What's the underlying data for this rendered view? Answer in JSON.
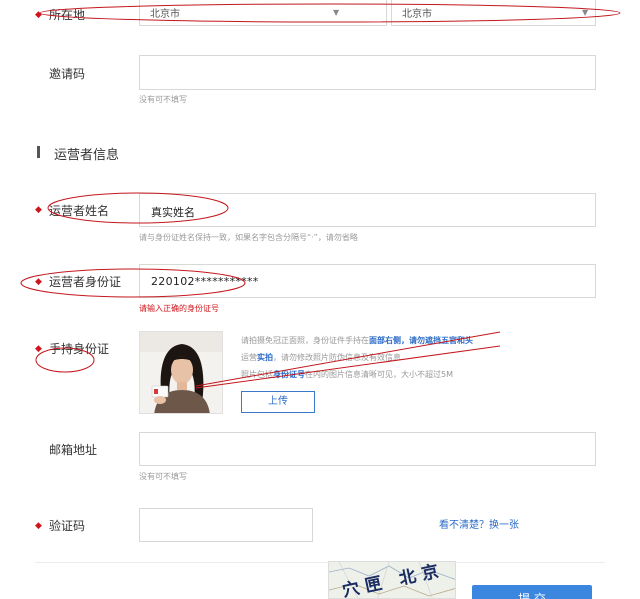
{
  "location": {
    "label": "所在地",
    "province_value": "北京市",
    "city_value": "北京市"
  },
  "invite": {
    "label": "邀请码",
    "value": "",
    "hint": "没有可不填写"
  },
  "section": {
    "title": "运营者信息"
  },
  "operator_name": {
    "label": "运营者姓名",
    "value": "真实姓名",
    "hint": "请与身份证姓名保持一致，如果名字包含分隔号“·”，请勿省略"
  },
  "operator_id": {
    "label": "运营者身份证",
    "value": "220102***********",
    "error": "请输入正确的身份证号"
  },
  "handheld_id": {
    "label": "手持身份证",
    "lines": [
      {
        "pre": "请拍摄免冠正面照，身份证件手持在",
        "em": "面部右侧，请勿遮挡五官和头",
        "post": ""
      },
      {
        "pre": "运营",
        "em": "实拍",
        "post": "，请勿修改照片防伪信息及有效信息"
      },
      {
        "pre": "照片包括",
        "em": "身份证号",
        "post": "在内的图片信息清晰可见，大小不超过5M"
      }
    ],
    "upload_label": "上传"
  },
  "email": {
    "label": "邮箱地址",
    "value": "",
    "hint": "没有可不填写"
  },
  "captcha": {
    "label": "验证码",
    "value": "",
    "refresh_link": "看不清楚？换一张",
    "image_text": "穴匣 北京"
  },
  "submit": {
    "label": "提 交"
  },
  "colors": {
    "required_mark": "#d0141b",
    "link": "#2b6bc7",
    "button_primary": "#3b87e0",
    "annotation_ink": "#c4171e"
  }
}
